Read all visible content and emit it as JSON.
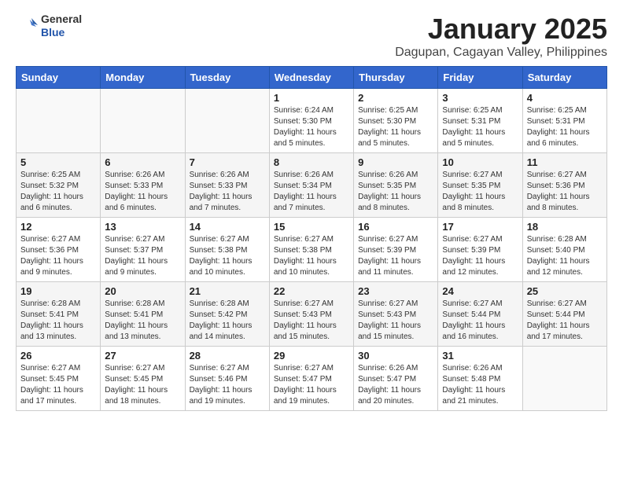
{
  "header": {
    "logo_general": "General",
    "logo_blue": "Blue",
    "month_title": "January 2025",
    "location": "Dagupan, Cagayan Valley, Philippines"
  },
  "days_of_week": [
    "Sunday",
    "Monday",
    "Tuesday",
    "Wednesday",
    "Thursday",
    "Friday",
    "Saturday"
  ],
  "weeks": [
    [
      {
        "day": "",
        "sunrise": "",
        "sunset": "",
        "daylight": ""
      },
      {
        "day": "",
        "sunrise": "",
        "sunset": "",
        "daylight": ""
      },
      {
        "day": "",
        "sunrise": "",
        "sunset": "",
        "daylight": ""
      },
      {
        "day": "1",
        "sunrise": "Sunrise: 6:24 AM",
        "sunset": "Sunset: 5:30 PM",
        "daylight": "Daylight: 11 hours and 5 minutes."
      },
      {
        "day": "2",
        "sunrise": "Sunrise: 6:25 AM",
        "sunset": "Sunset: 5:30 PM",
        "daylight": "Daylight: 11 hours and 5 minutes."
      },
      {
        "day": "3",
        "sunrise": "Sunrise: 6:25 AM",
        "sunset": "Sunset: 5:31 PM",
        "daylight": "Daylight: 11 hours and 5 minutes."
      },
      {
        "day": "4",
        "sunrise": "Sunrise: 6:25 AM",
        "sunset": "Sunset: 5:31 PM",
        "daylight": "Daylight: 11 hours and 6 minutes."
      }
    ],
    [
      {
        "day": "5",
        "sunrise": "Sunrise: 6:25 AM",
        "sunset": "Sunset: 5:32 PM",
        "daylight": "Daylight: 11 hours and 6 minutes."
      },
      {
        "day": "6",
        "sunrise": "Sunrise: 6:26 AM",
        "sunset": "Sunset: 5:33 PM",
        "daylight": "Daylight: 11 hours and 6 minutes."
      },
      {
        "day": "7",
        "sunrise": "Sunrise: 6:26 AM",
        "sunset": "Sunset: 5:33 PM",
        "daylight": "Daylight: 11 hours and 7 minutes."
      },
      {
        "day": "8",
        "sunrise": "Sunrise: 6:26 AM",
        "sunset": "Sunset: 5:34 PM",
        "daylight": "Daylight: 11 hours and 7 minutes."
      },
      {
        "day": "9",
        "sunrise": "Sunrise: 6:26 AM",
        "sunset": "Sunset: 5:35 PM",
        "daylight": "Daylight: 11 hours and 8 minutes."
      },
      {
        "day": "10",
        "sunrise": "Sunrise: 6:27 AM",
        "sunset": "Sunset: 5:35 PM",
        "daylight": "Daylight: 11 hours and 8 minutes."
      },
      {
        "day": "11",
        "sunrise": "Sunrise: 6:27 AM",
        "sunset": "Sunset: 5:36 PM",
        "daylight": "Daylight: 11 hours and 8 minutes."
      }
    ],
    [
      {
        "day": "12",
        "sunrise": "Sunrise: 6:27 AM",
        "sunset": "Sunset: 5:36 PM",
        "daylight": "Daylight: 11 hours and 9 minutes."
      },
      {
        "day": "13",
        "sunrise": "Sunrise: 6:27 AM",
        "sunset": "Sunset: 5:37 PM",
        "daylight": "Daylight: 11 hours and 9 minutes."
      },
      {
        "day": "14",
        "sunrise": "Sunrise: 6:27 AM",
        "sunset": "Sunset: 5:38 PM",
        "daylight": "Daylight: 11 hours and 10 minutes."
      },
      {
        "day": "15",
        "sunrise": "Sunrise: 6:27 AM",
        "sunset": "Sunset: 5:38 PM",
        "daylight": "Daylight: 11 hours and 10 minutes."
      },
      {
        "day": "16",
        "sunrise": "Sunrise: 6:27 AM",
        "sunset": "Sunset: 5:39 PM",
        "daylight": "Daylight: 11 hours and 11 minutes."
      },
      {
        "day": "17",
        "sunrise": "Sunrise: 6:27 AM",
        "sunset": "Sunset: 5:39 PM",
        "daylight": "Daylight: 11 hours and 12 minutes."
      },
      {
        "day": "18",
        "sunrise": "Sunrise: 6:28 AM",
        "sunset": "Sunset: 5:40 PM",
        "daylight": "Daylight: 11 hours and 12 minutes."
      }
    ],
    [
      {
        "day": "19",
        "sunrise": "Sunrise: 6:28 AM",
        "sunset": "Sunset: 5:41 PM",
        "daylight": "Daylight: 11 hours and 13 minutes."
      },
      {
        "day": "20",
        "sunrise": "Sunrise: 6:28 AM",
        "sunset": "Sunset: 5:41 PM",
        "daylight": "Daylight: 11 hours and 13 minutes."
      },
      {
        "day": "21",
        "sunrise": "Sunrise: 6:28 AM",
        "sunset": "Sunset: 5:42 PM",
        "daylight": "Daylight: 11 hours and 14 minutes."
      },
      {
        "day": "22",
        "sunrise": "Sunrise: 6:27 AM",
        "sunset": "Sunset: 5:43 PM",
        "daylight": "Daylight: 11 hours and 15 minutes."
      },
      {
        "day": "23",
        "sunrise": "Sunrise: 6:27 AM",
        "sunset": "Sunset: 5:43 PM",
        "daylight": "Daylight: 11 hours and 15 minutes."
      },
      {
        "day": "24",
        "sunrise": "Sunrise: 6:27 AM",
        "sunset": "Sunset: 5:44 PM",
        "daylight": "Daylight: 11 hours and 16 minutes."
      },
      {
        "day": "25",
        "sunrise": "Sunrise: 6:27 AM",
        "sunset": "Sunset: 5:44 PM",
        "daylight": "Daylight: 11 hours and 17 minutes."
      }
    ],
    [
      {
        "day": "26",
        "sunrise": "Sunrise: 6:27 AM",
        "sunset": "Sunset: 5:45 PM",
        "daylight": "Daylight: 11 hours and 17 minutes."
      },
      {
        "day": "27",
        "sunrise": "Sunrise: 6:27 AM",
        "sunset": "Sunset: 5:45 PM",
        "daylight": "Daylight: 11 hours and 18 minutes."
      },
      {
        "day": "28",
        "sunrise": "Sunrise: 6:27 AM",
        "sunset": "Sunset: 5:46 PM",
        "daylight": "Daylight: 11 hours and 19 minutes."
      },
      {
        "day": "29",
        "sunrise": "Sunrise: 6:27 AM",
        "sunset": "Sunset: 5:47 PM",
        "daylight": "Daylight: 11 hours and 19 minutes."
      },
      {
        "day": "30",
        "sunrise": "Sunrise: 6:26 AM",
        "sunset": "Sunset: 5:47 PM",
        "daylight": "Daylight: 11 hours and 20 minutes."
      },
      {
        "day": "31",
        "sunrise": "Sunrise: 6:26 AM",
        "sunset": "Sunset: 5:48 PM",
        "daylight": "Daylight: 11 hours and 21 minutes."
      },
      {
        "day": "",
        "sunrise": "",
        "sunset": "",
        "daylight": ""
      }
    ]
  ]
}
